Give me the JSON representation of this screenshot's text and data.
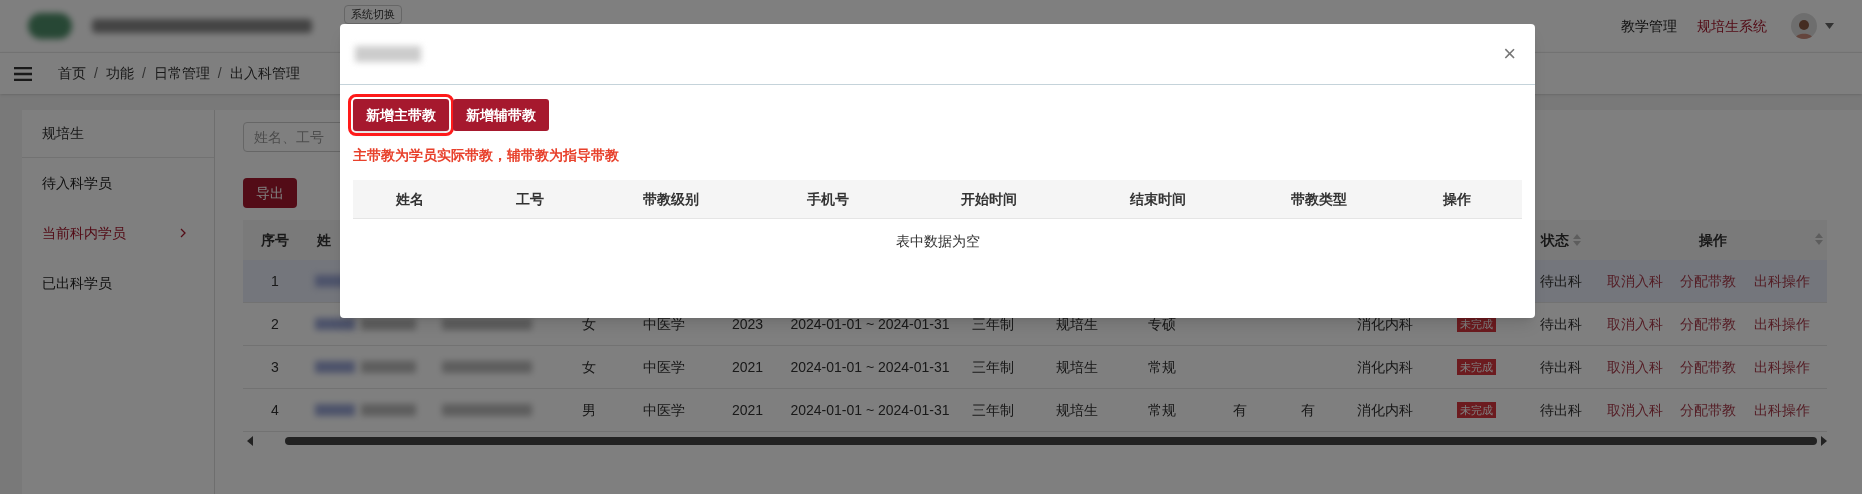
{
  "header": {
    "system_switch": "系统切换",
    "nav": [
      {
        "label": "教学管理",
        "selected": false
      },
      {
        "label": "规培生系统",
        "selected": true
      }
    ]
  },
  "breadcrumb": {
    "separator": "/",
    "items": [
      "首页",
      "功能",
      "日常管理",
      "出入科管理"
    ]
  },
  "sidebar": {
    "title": "规培生",
    "items": [
      {
        "label": "待入科学员",
        "selected": false
      },
      {
        "label": "当前科内学员",
        "selected": true
      },
      {
        "label": "已出科学员",
        "selected": false
      }
    ]
  },
  "search": {
    "placeholder": "姓名、工号"
  },
  "export_button": "导出",
  "table": {
    "columns": {
      "index": "序号",
      "name": "姓",
      "status": "状态",
      "actions": "操作"
    },
    "rows": [
      {
        "selected": true,
        "index": "1",
        "status": "待出科",
        "actions": [
          "取消入科",
          "分配带教",
          "出科操作"
        ]
      },
      {
        "selected": false,
        "index": "2",
        "sex": "女",
        "major": "中医学",
        "grade": "2023",
        "period": "2024-01-01 ~ 2024-01-31",
        "system": "三年制",
        "type": "规培生",
        "category": "专硕",
        "dept": "消化内科",
        "badge": "未完成",
        "status": "待出科",
        "actions": [
          "取消入科",
          "分配带教",
          "出科操作"
        ]
      },
      {
        "selected": false,
        "index": "3",
        "sex": "女",
        "major": "中医学",
        "grade": "2021",
        "period": "2024-01-01 ~ 2024-01-31",
        "system": "三年制",
        "type": "规培生",
        "category": "常规",
        "dept": "消化内科",
        "badge": "未完成",
        "status": "待出科",
        "actions": [
          "取消入科",
          "分配带教",
          "出科操作"
        ]
      },
      {
        "selected": false,
        "index": "4",
        "sex": "男",
        "major": "中医学",
        "grade": "2021",
        "period": "2024-01-01 ~ 2024-01-31",
        "system": "三年制",
        "type": "规培生",
        "category": "常规",
        "column_10": "有",
        "column_11": "有",
        "dept": "消化内科",
        "badge": "未完成",
        "status": "待出科",
        "actions": [
          "取消入科",
          "分配带教",
          "出科操作"
        ]
      }
    ]
  },
  "modal": {
    "close": "×",
    "buttons": [
      {
        "label": "新增主带教",
        "highlighted": true
      },
      {
        "label": "新增辅带教",
        "highlighted": false
      }
    ],
    "note": "主带教为学员实际带教，辅带教为指导带教",
    "table": {
      "columns": [
        "姓名",
        "工号",
        "带教级别",
        "手机号",
        "开始时间",
        "结束时间",
        "带教类型",
        "操作"
      ],
      "empty_text": "表中数据为空"
    }
  }
}
